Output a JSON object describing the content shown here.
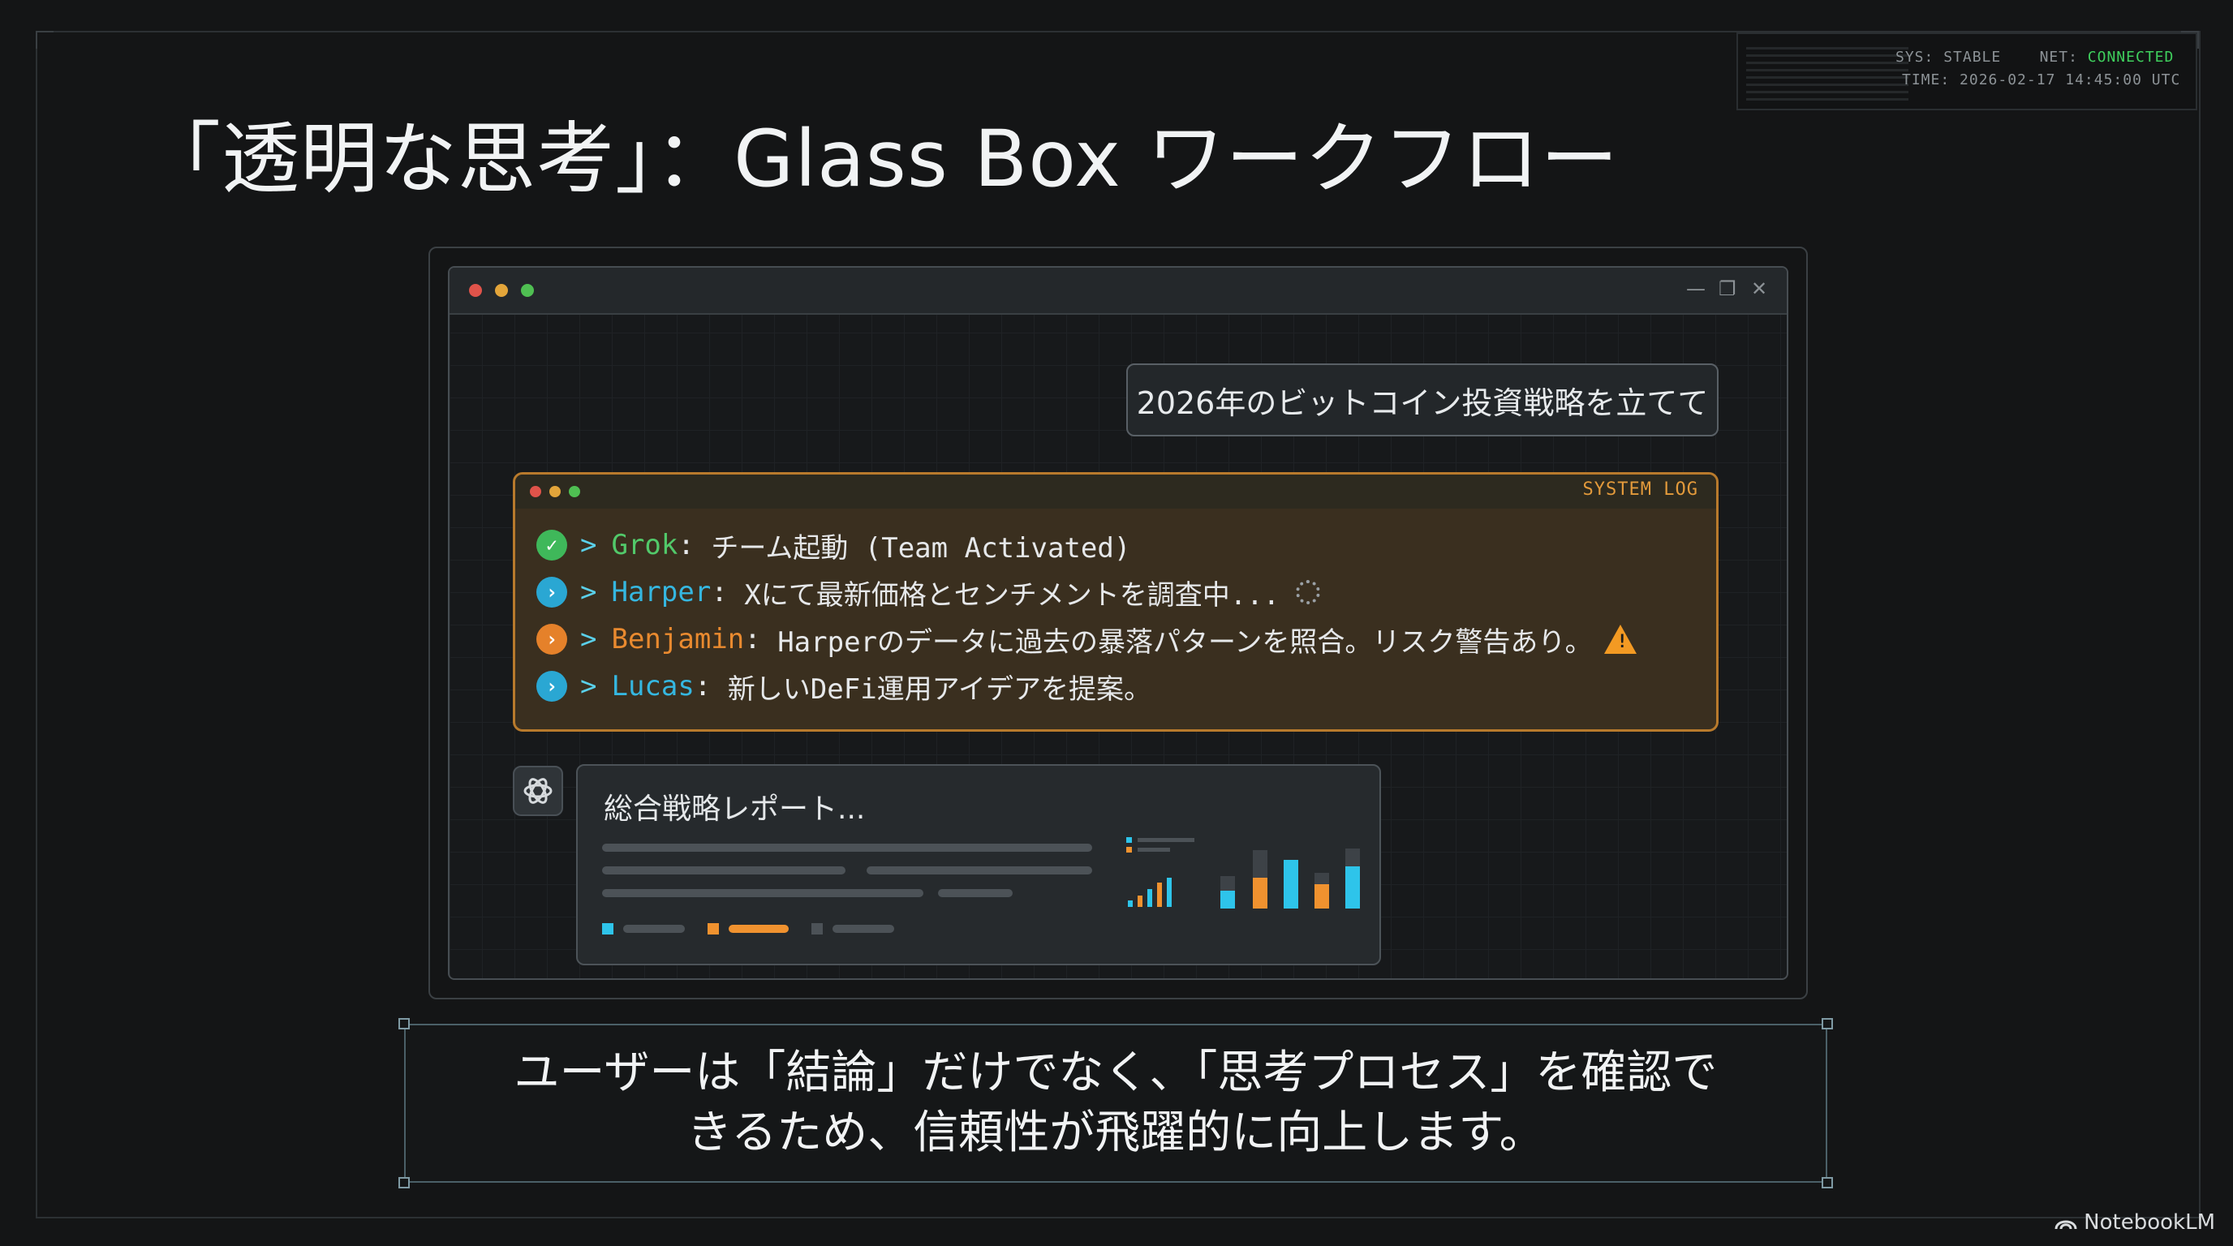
{
  "status": {
    "sys_label": "SYS:",
    "sys_value": "STABLE",
    "net_label": "NET:",
    "net_value": "CONNECTED",
    "time_label": "TIME:",
    "time_value": "2026-02-17 14:45:00 UTC"
  },
  "slide": {
    "title": "「透明な思考」：Glass Box ワークフロー"
  },
  "window": {
    "user_message": "2026年のビットコイン投資戦略を立てて"
  },
  "system_log": {
    "title": "SYSTEM LOG",
    "entries": [
      {
        "name": "Grok",
        "sep": ": ",
        "text": "チーム起動 (Team Activated)",
        "status": "done",
        "color": "#52c96a"
      },
      {
        "name": "Harper",
        "sep": ": ",
        "text": "Xにて最新価格とセンチメントを調査中...",
        "status": "in-progress",
        "color": "#35b7e0"
      },
      {
        "name": "Benjamin",
        "sep": ": ",
        "text": "Harperのデータに過去の暴落パターンを照合。リスク警告あり。",
        "status": "warning",
        "color": "#e98a2f"
      },
      {
        "name": "Lucas",
        "sep": ": ",
        "text": "新しいDeFi運用アイデアを提案。",
        "status": "in-progress",
        "color": "#35b7e0"
      }
    ]
  },
  "report": {
    "title": "総合戦略レポート..."
  },
  "caption": {
    "line1": "ユーザーは「結論」だけでなく、「思考プロセス」を確認で",
    "line2": "きるため、信頼性が飛躍的に向上します。"
  },
  "brand": {
    "label": "NotebookLM"
  },
  "colors": {
    "accent_orange": "#e98a2f",
    "accent_cyan": "#35b7e0",
    "accent_green": "#52c96a",
    "log_border": "#b87a2c"
  }
}
